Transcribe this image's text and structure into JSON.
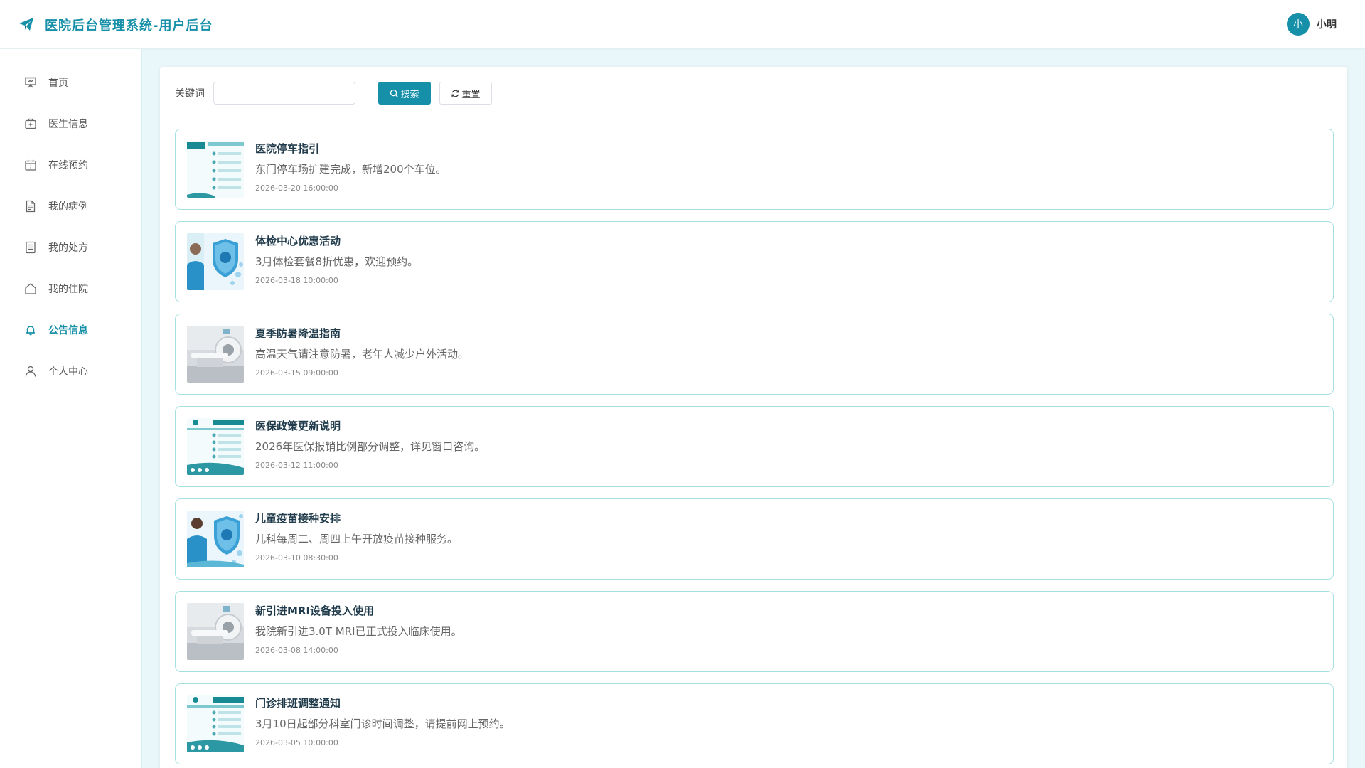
{
  "header": {
    "title": "医院后台管理系统-用户后台",
    "avatar_text": "小",
    "username": "小明"
  },
  "theme": {
    "primary": "#1590a8",
    "border": "#a5e0e0",
    "background": "#eaf7fa"
  },
  "sidebar": {
    "items": [
      {
        "label": "首页",
        "icon": "presentation-icon",
        "active": false
      },
      {
        "label": "医生信息",
        "icon": "medical-kit-icon",
        "active": false
      },
      {
        "label": "在线预约",
        "icon": "calendar-icon",
        "active": false
      },
      {
        "label": "我的病例",
        "icon": "document-icon",
        "active": false
      },
      {
        "label": "我的处方",
        "icon": "list-document-icon",
        "active": false
      },
      {
        "label": "我的住院",
        "icon": "house-icon",
        "active": false
      },
      {
        "label": "公告信息",
        "icon": "bell-icon",
        "active": true
      },
      {
        "label": "个人中心",
        "icon": "user-icon",
        "active": false
      }
    ]
  },
  "search": {
    "label": "关键词",
    "value": "",
    "placeholder": "",
    "search_label": "搜索",
    "reset_label": "重置"
  },
  "notices": [
    {
      "title": "医院停车指引",
      "description": "东门停车场扩建完成，新增200个车位。",
      "time": "2026-03-20 16:00:00",
      "thumb": "schedule-chart-image"
    },
    {
      "title": "体检中心优惠活动",
      "description": "3月体检套餐8折优惠，欢迎预约。",
      "time": "2026-03-18 10:00:00",
      "thumb": "doctor-shield-image"
    },
    {
      "title": "夏季防暑降温指南",
      "description": "高温天气请注意防暑，老年人减少户外活动。",
      "time": "2026-03-15 09:00:00",
      "thumb": "mri-room-image"
    },
    {
      "title": "医保政策更新说明",
      "description": "2026年医保报销比例部分调整，详见窗口咨询。",
      "time": "2026-03-12 11:00:00",
      "thumb": "schedule-chart-image"
    },
    {
      "title": "儿童疫苗接种安排",
      "description": "儿科每周二、周四上午开放疫苗接种服务。",
      "time": "2026-03-10 08:30:00",
      "thumb": "doctor-shield-image"
    },
    {
      "title": "新引进MRI设备投入使用",
      "description": "我院新引进3.0T MRI已正式投入临床使用。",
      "time": "2026-03-08 14:00:00",
      "thumb": "mri-room-image"
    },
    {
      "title": "门诊排班调整通知",
      "description": "3月10日起部分科室门诊时间调整，请提前网上预约。",
      "time": "2026-03-05 10:00:00",
      "thumb": "schedule-chart-image"
    }
  ]
}
